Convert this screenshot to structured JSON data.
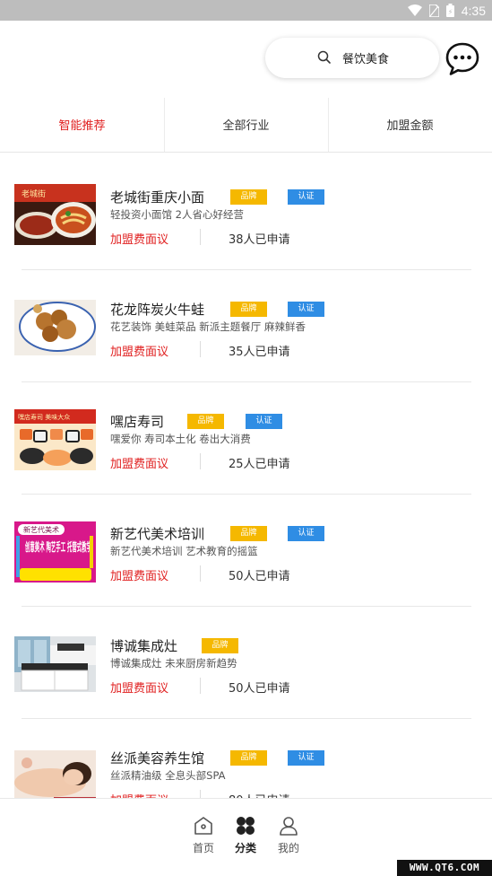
{
  "status_bar": {
    "time": "4:35",
    "colors": {
      "bar": "#bdbdbd"
    }
  },
  "search": {
    "text": "餐饮美食"
  },
  "tabs": [
    {
      "label": "智能推荐",
      "active": true
    },
    {
      "label": "全部行业",
      "active": false
    },
    {
      "label": "加盟金额",
      "active": false
    }
  ],
  "badge_labels": {
    "brand": "品牌",
    "cert": "认证"
  },
  "items": [
    {
      "title": "老城街重庆小面",
      "desc": "轻投资小面馆 2人省心好经营",
      "fee": "加盟费面议",
      "applied": "38人已申请",
      "brand": true,
      "cert": true,
      "thumb_text": "老城街"
    },
    {
      "title": "花龙阵炭火牛蛙",
      "desc": "花艺装饰 美蛙菜品 新派主题餐厅 麻辣鲜香",
      "fee": "加盟费面议",
      "applied": "35人已申请",
      "brand": true,
      "cert": true,
      "thumb_text": ""
    },
    {
      "title": "嘿店寿司",
      "desc": "嘿爱你 寿司本土化 卷出大消费",
      "fee": "加盟费面议",
      "applied": "25人已申请",
      "brand": true,
      "cert": true,
      "thumb_text": "嘿店寿司 美味大众"
    },
    {
      "title": "新艺代美术培训",
      "desc": "新艺代美术培训 艺术教育的摇篮",
      "fee": "加盟费面议",
      "applied": "50人已申请",
      "brand": true,
      "cert": true,
      "thumb_text": "创意美术 陶艺手工 托管式教学",
      "thumb_small": "新艺代美术"
    },
    {
      "title": "博诚集成灶",
      "desc": "博诚集成灶 未来厨房新趋势",
      "fee": "加盟费面议",
      "applied": "50人已申请",
      "brand": true,
      "cert": false,
      "thumb_text": ""
    },
    {
      "title": "丝派美容养生馆",
      "desc": "丝派精油级 全息头部SPA",
      "fee": "加盟费面议",
      "applied": "80人已申请",
      "brand": true,
      "cert": true,
      "thumb_text": ""
    }
  ],
  "nav": [
    {
      "label": "首页",
      "icon": "home-icon",
      "active": false
    },
    {
      "label": "分类",
      "icon": "category-icon",
      "active": true
    },
    {
      "label": "我的",
      "icon": "profile-icon",
      "active": false
    }
  ],
  "watermark": "WWW.QT6.COM",
  "colors": {
    "accent_red": "#e02020",
    "brand_badge": "#f5b800",
    "cert_badge": "#2f8de4"
  }
}
